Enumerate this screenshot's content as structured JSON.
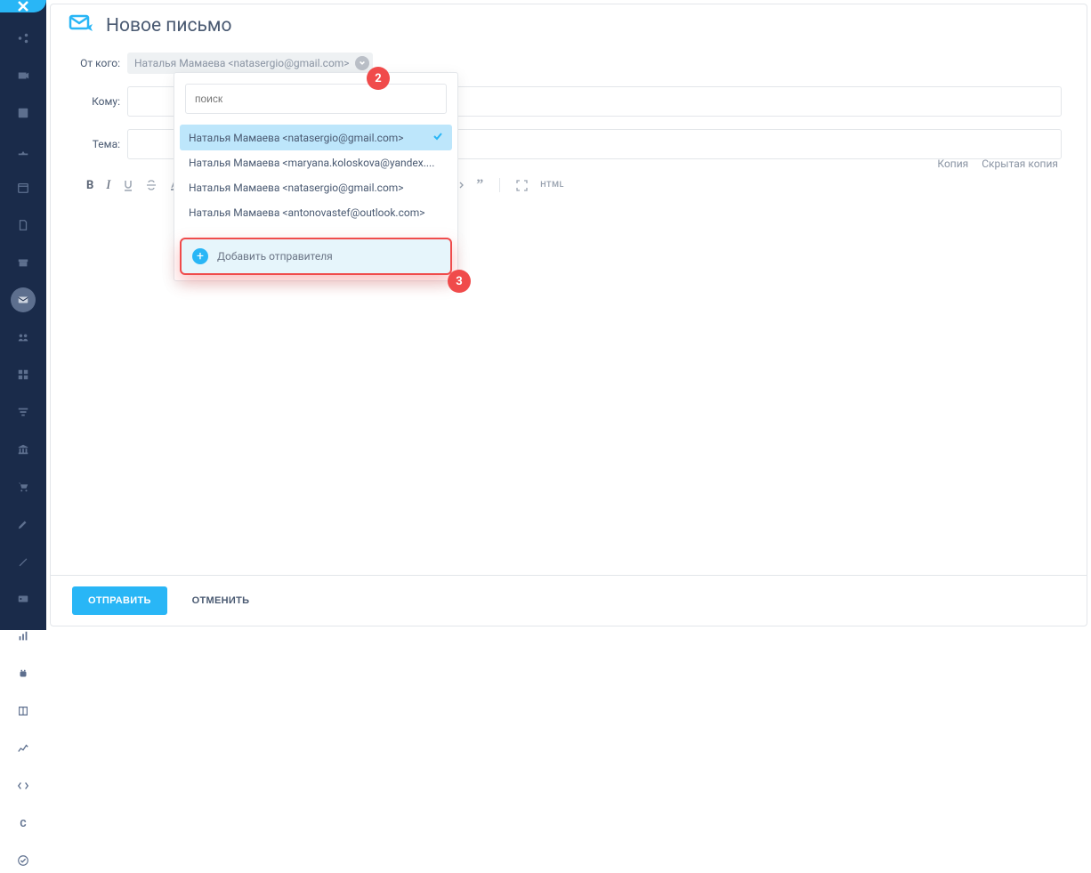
{
  "page": {
    "title": "Новое письмо"
  },
  "labels": {
    "from": "От кого:",
    "to": "Кому:",
    "subject": "Тема:",
    "cc": "Копия",
    "bcc": "Скрытая копия"
  },
  "from": {
    "display": "Наталья Мамаева <natasergio@gmail.com>"
  },
  "dropdown": {
    "search_placeholder": "поиск",
    "options": [
      {
        "label": "Наталья Мамаева <natasergio@gmail.com>",
        "selected": true
      },
      {
        "label": "Наталья Мамаева <maryana.koloskova@yandex....",
        "selected": false
      },
      {
        "label": "Наталья Мамаева <natasergio@gmail.com>",
        "selected": false
      },
      {
        "label": "Наталья Мамаева <antonovastef@outlook.com>",
        "selected": false
      }
    ],
    "add_label": "Добавить отправителя"
  },
  "badges": {
    "b2": "2",
    "b3": "3"
  },
  "footer": {
    "send": "ОТПРАВИТЬ",
    "cancel": "ОТМЕНИТЬ"
  },
  "toolbar": {
    "bold": "B",
    "italic": "I",
    "html": "HTML"
  },
  "sidebar": {
    "letter": "C"
  }
}
